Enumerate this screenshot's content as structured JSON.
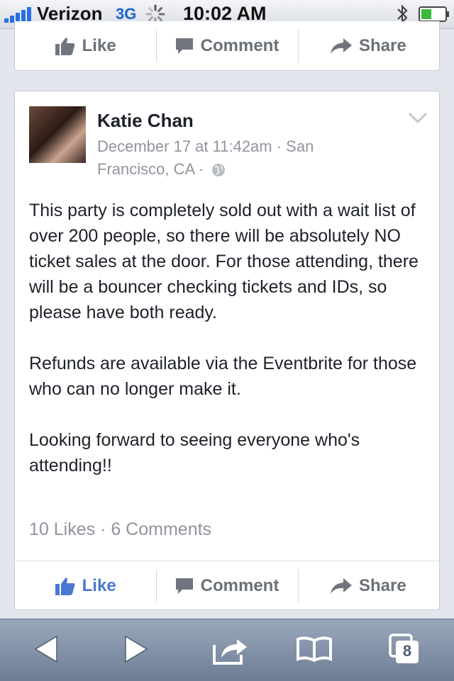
{
  "status_bar": {
    "carrier": "Verizon",
    "network": "3G",
    "time": "10:02 AM"
  },
  "previous_post_actions": {
    "like": "Like",
    "comment": "Comment",
    "share": "Share"
  },
  "post": {
    "author": "Katie Chan",
    "meta_text": "December 17 at 11:42am · San Francisco, CA ·",
    "paragraphs": [
      "This party is completely sold out with a wait list of over 200 people, so there will be absolutely NO ticket sales at the door. For those attending, there will be a bouncer checking tickets and IDs, so please have both ready.",
      "Refunds are available via the Eventbrite for those who can no longer make it.",
      "Looking forward to seeing everyone who's attending!!"
    ],
    "counts": "10 Likes · 6 Comments",
    "actions": {
      "like": "Like",
      "comment": "Comment",
      "share": "Share"
    },
    "like_active_color": "#4a78d0"
  },
  "toolbar": {
    "tabs_count": "8"
  }
}
